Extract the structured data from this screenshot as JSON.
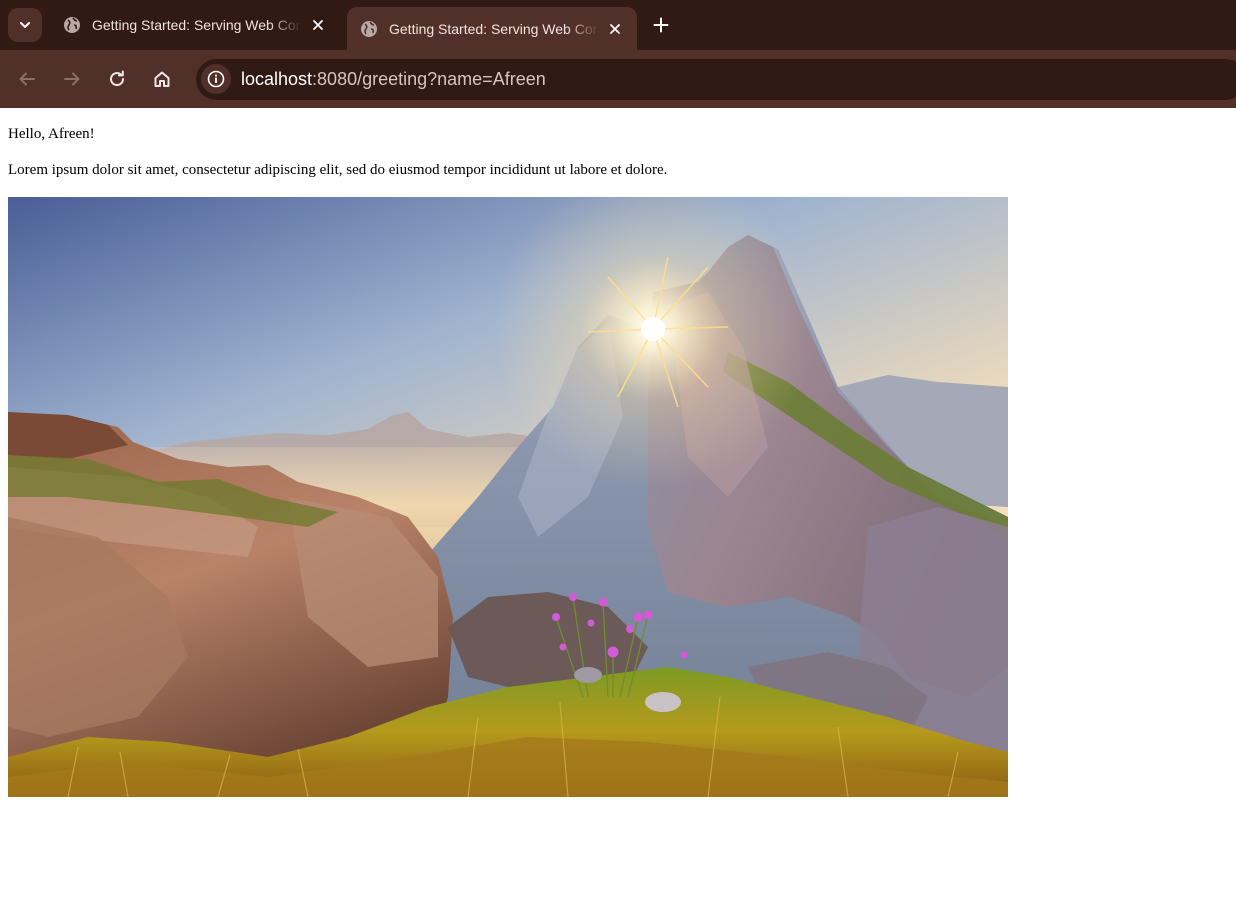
{
  "browser": {
    "tabs": [
      {
        "title": "Getting Started: Serving Web Content",
        "active": false,
        "icon": "globe-icon"
      },
      {
        "title": "Getting Started: Serving Web Content",
        "active": true,
        "icon": "globe-icon"
      }
    ],
    "address_bar": {
      "host": "localhost",
      "rest": ":8080/greeting?name=Afreen"
    },
    "theme": {
      "frame": "#311914",
      "toolbar": "#52302a"
    }
  },
  "page": {
    "greeting": "Hello, Afreen!",
    "paragraph": "Lorem ipsum dolor sit amet, consectetur adipiscing elit, sed do eiusmod tempor incididunt ut labore et dolore.",
    "image": {
      "subject": "mountain-sunrise-photo"
    }
  }
}
